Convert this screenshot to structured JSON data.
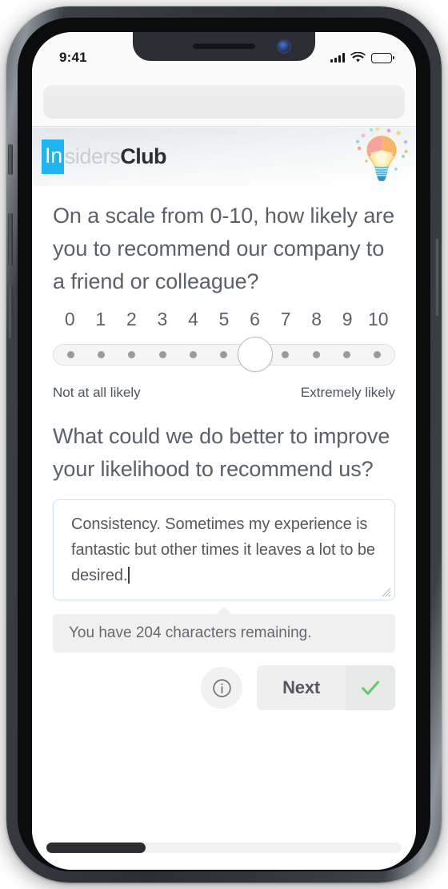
{
  "status_bar": {
    "time": "9:41",
    "signal_icon": "signal-bars-icon",
    "wifi_icon": "wifi-icon",
    "battery_icon": "battery-full-icon"
  },
  "browser": {
    "url_value": "",
    "url_placeholder": "",
    "reload_icon": "reload-icon"
  },
  "brand": {
    "logo_part1": "In",
    "logo_part2": "siders",
    "logo_part3": "Club",
    "mark_icon": "lightbulb-icon",
    "accent_color": "#20b4f0"
  },
  "survey": {
    "question1": "On a scale from 0-10, how likely are you to recommend our company to a friend or colleague?",
    "scale": {
      "labels": [
        "0",
        "1",
        "2",
        "3",
        "4",
        "5",
        "6",
        "7",
        "8",
        "9",
        "10"
      ],
      "selected_value": 6,
      "min_anchor": "Not at all likely",
      "max_anchor": "Extremely likely"
    },
    "question2": "What could we do better to improve your likelihood to recommend us?",
    "answer": {
      "value": "Consistency. Sometimes my experience is fantastic but other times it leaves a lot to be desired.",
      "placeholder": "",
      "resize_handle_icon": "resize-handle-icon"
    },
    "character_counter": "You have 204 characters remaining."
  },
  "actions": {
    "info_icon": "info-circle-icon",
    "next_label": "Next",
    "confirm_icon": "check-icon",
    "confirm_color": "#5ece5e"
  },
  "progress": {
    "percent": 28
  }
}
